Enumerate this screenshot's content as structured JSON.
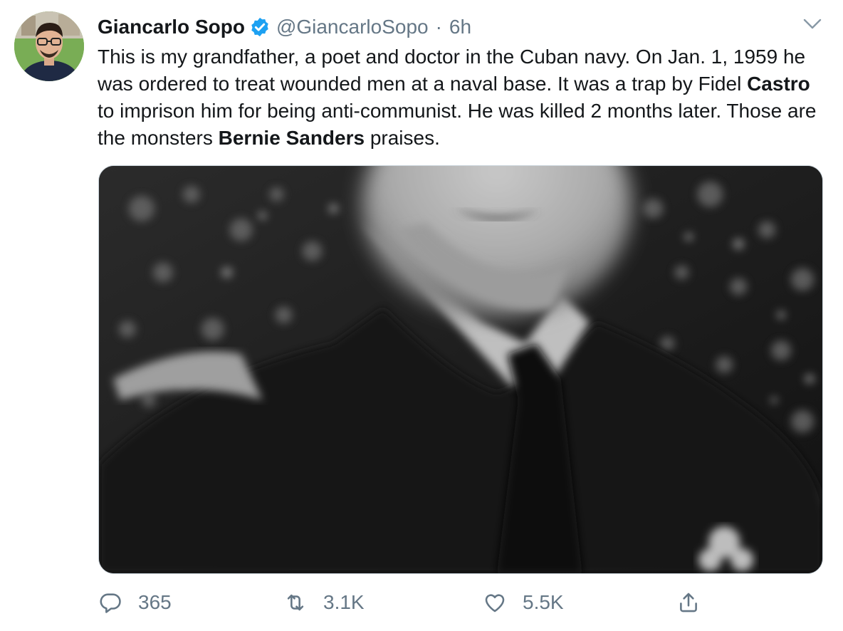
{
  "author": {
    "display_name": "Giancarlo Sopo",
    "handle": "@GiancarloSopo",
    "separator": "·",
    "time": "6h",
    "verified": true
  },
  "text": {
    "part1": "This is my grandfather, a poet and doctor in the Cuban navy. On Jan. 1, 1959 he was ordered to treat wounded men at a naval base. It was a trap by Fidel ",
    "bold1": "Castro",
    "part2": " to imprison him for being anti-communist. He was killed 2 months later. Those are the monsters ",
    "bold2": "Bernie Sanders",
    "part3": " praises."
  },
  "actions": {
    "replies": "365",
    "retweets": "3.1K",
    "likes": "5.5K"
  },
  "icons": {
    "verified": "verified-badge-icon",
    "caret": "chevron-down-icon",
    "reply": "reply-icon",
    "retweet": "retweet-icon",
    "like": "heart-icon",
    "share": "share-icon"
  },
  "colors": {
    "text": "#14171a",
    "secondary": "#657786",
    "verified": "#1da1f2"
  }
}
